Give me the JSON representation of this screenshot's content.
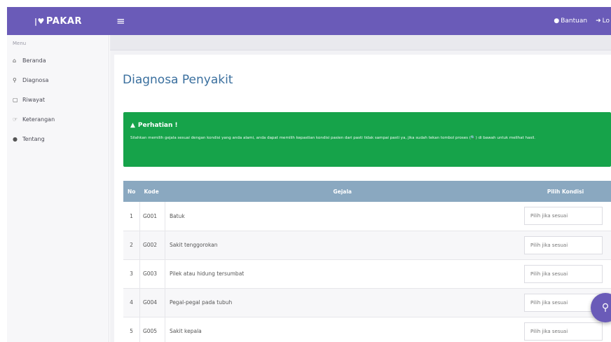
{
  "brand": {
    "name": "PAKAR"
  },
  "topbar": {
    "menu_icon": "hamburger-icon",
    "help_label": "Bantuan",
    "login_label": "Lo"
  },
  "sidebar": {
    "heading": "Menu",
    "items": [
      {
        "label": "Beranda",
        "icon": "home-icon"
      },
      {
        "label": "Diagnosa",
        "icon": "search-icon"
      },
      {
        "label": "Riwayat",
        "icon": "history-icon"
      },
      {
        "label": "Keterangan",
        "icon": "info-icon"
      },
      {
        "label": "Tentang",
        "icon": "about-icon"
      }
    ]
  },
  "main": {
    "title": "Diagnosa Penyakit"
  },
  "alert": {
    "title": "Perhatian !",
    "body": "Silahkan memilih gejala sesuai dengan kondisi yang anda alami, anda dapat memilih kepastian kondisi pasien dari pasti tidak sampai pasti ya, jika sudah tekan tombol proses (🔍) di bawah untuk melihat hasil."
  },
  "table": {
    "headers": {
      "no": "No",
      "kode": "Kode",
      "gejala": "Gejala",
      "pilih": "Pilih Kondisi"
    },
    "rows": [
      {
        "no": "1",
        "kode": "G001",
        "gejala": "Batuk",
        "pilih": "Pilih jika sesuai"
      },
      {
        "no": "2",
        "kode": "G002",
        "gejala": "Sakit tenggorokan",
        "pilih": "Pilih jika sesuai"
      },
      {
        "no": "3",
        "kode": "G003",
        "gejala": "Pilek atau hidung tersumbat",
        "pilih": "Pilih jika sesuai"
      },
      {
        "no": "4",
        "kode": "G004",
        "gejala": "Pegal-pegal pada tubuh",
        "pilih": "Pilih jika sesuai"
      },
      {
        "no": "5",
        "kode": "G005",
        "gejala": "Sakit kepala",
        "pilih": "Pilih jika sesuai"
      }
    ]
  },
  "colors": {
    "accent": "#6a5bb8",
    "alert": "#16a34a",
    "table_header": "#8aa8c0",
    "title": "#3a6f9e"
  }
}
